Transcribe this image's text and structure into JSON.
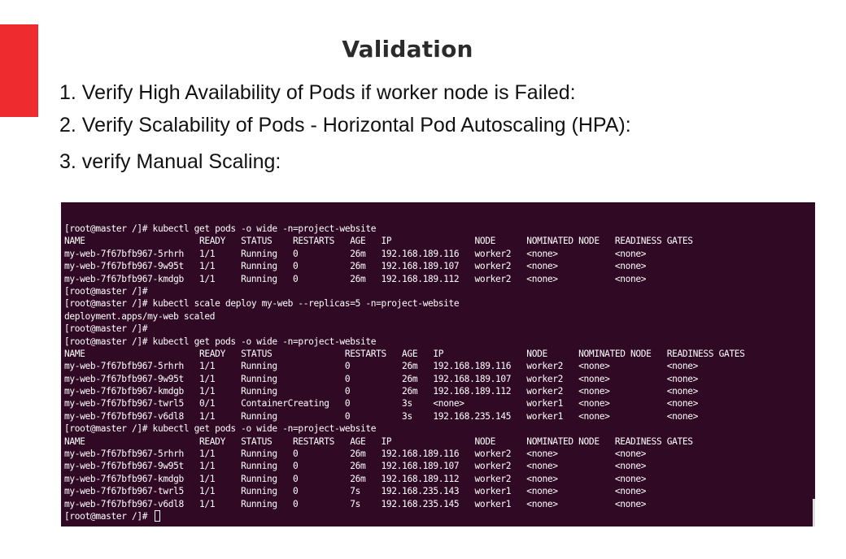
{
  "slide": {
    "title": "Validation",
    "accent_color": "#ee2b2f",
    "steps": [
      "1. Verify High Availability of Pods if worker node is Failed:",
      "2. Verify Scalability of Pods - Horizontal Pod Autoscaling (HPA):",
      "3. verify Manual Scaling:"
    ]
  },
  "terminal": {
    "background_color": "#300a24",
    "lines": [
      "[root@master /]# kubectl get pods -o wide -n=project-website",
      "NAME                      READY   STATUS    RESTARTS   AGE   IP                NODE      NOMINATED NODE   READINESS GATES",
      "my-web-7f67bfb967-5rhrh   1/1     Running   0          26m   192.168.189.116   worker2   <none>           <none>",
      "my-web-7f67bfb967-9w95t   1/1     Running   0          26m   192.168.189.107   worker2   <none>           <none>",
      "my-web-7f67bfb967-kmdgb   1/1     Running   0          26m   192.168.189.112   worker2   <none>           <none>",
      "[root@master /]#",
      "[root@master /]# kubectl scale deploy my-web --replicas=5 -n=project-website",
      "deployment.apps/my-web scaled",
      "[root@master /]#",
      "[root@master /]# kubectl get pods -o wide -n=project-website",
      "NAME                      READY   STATUS              RESTARTS   AGE   IP                NODE      NOMINATED NODE   READINESS GATES",
      "my-web-7f67bfb967-5rhrh   1/1     Running             0          26m   192.168.189.116   worker2   <none>           <none>",
      "my-web-7f67bfb967-9w95t   1/1     Running             0          26m   192.168.189.107   worker2   <none>           <none>",
      "my-web-7f67bfb967-kmdgb   1/1     Running             0          26m   192.168.189.112   worker2   <none>           <none>",
      "my-web-7f67bfb967-twrl5   0/1     ContainerCreating   0          3s    <none>            worker1   <none>           <none>",
      "my-web-7f67bfb967-v6dl8   1/1     Running             0          3s    192.168.235.145   worker1   <none>           <none>",
      "[root@master /]# kubectl get pods -o wide -n=project-website",
      "NAME                      READY   STATUS    RESTARTS   AGE   IP                NODE      NOMINATED NODE   READINESS GATES",
      "my-web-7f67bfb967-5rhrh   1/1     Running   0          26m   192.168.189.116   worker2   <none>           <none>",
      "my-web-7f67bfb967-9w95t   1/1     Running   0          26m   192.168.189.107   worker2   <none>           <none>",
      "my-web-7f67bfb967-kmdgb   1/1     Running   0          26m   192.168.189.112   worker2   <none>           <none>",
      "my-web-7f67bfb967-twrl5   1/1     Running   0          7s    192.168.235.143   worker1   <none>           <none>",
      "my-web-7f67bfb967-v6dl8   1/1     Running   0          7s    192.168.235.145   worker1   <none>           <none>"
    ],
    "prompt": "[root@master /]# "
  }
}
